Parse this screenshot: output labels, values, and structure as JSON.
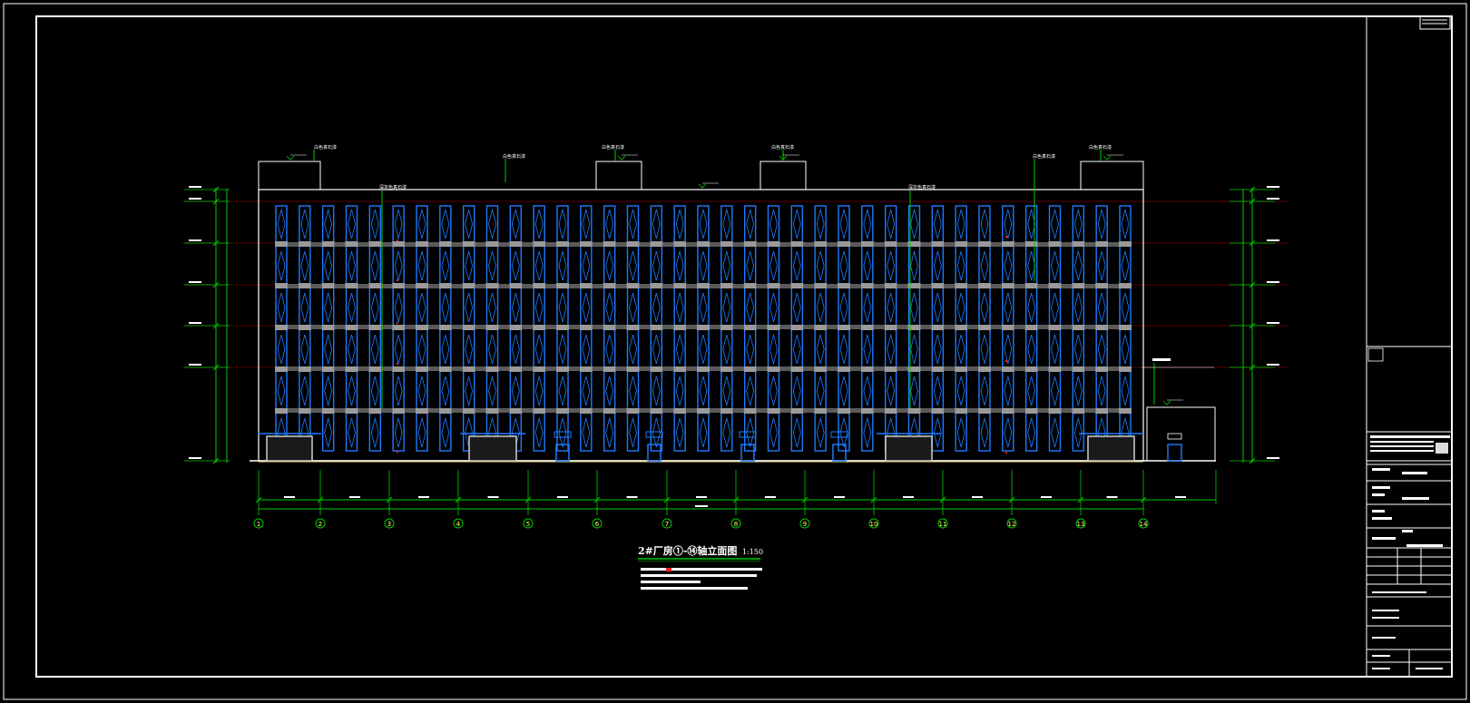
{
  "drawing": {
    "title": "2#厂房①-⑭轴立面图",
    "scale": "1:150"
  },
  "colors": {
    "background": "#000000",
    "frame": "#ffffff",
    "dimension": "#00cc00",
    "window": "#1e7bff",
    "band": "#9a9a9a",
    "level_line": "#7a0000",
    "marker": "#ff2020",
    "door": "#cfcfcf",
    "ground": "#e6d27a"
  },
  "axes": [
    "1",
    "2",
    "3",
    "4",
    "5",
    "6",
    "7",
    "8",
    "9",
    "10",
    "11",
    "12",
    "13",
    "14"
  ],
  "roof_callouts": [
    "白色真石漆",
    "白色真石漆",
    "白色真石漆",
    "白色真石漆",
    "白色真石漆",
    "白色真石漆"
  ],
  "window_bays": 37,
  "floors": 6,
  "notes": {
    "parapet_note": "白色真石漆",
    "facade_note": "深灰色真石漆"
  }
}
